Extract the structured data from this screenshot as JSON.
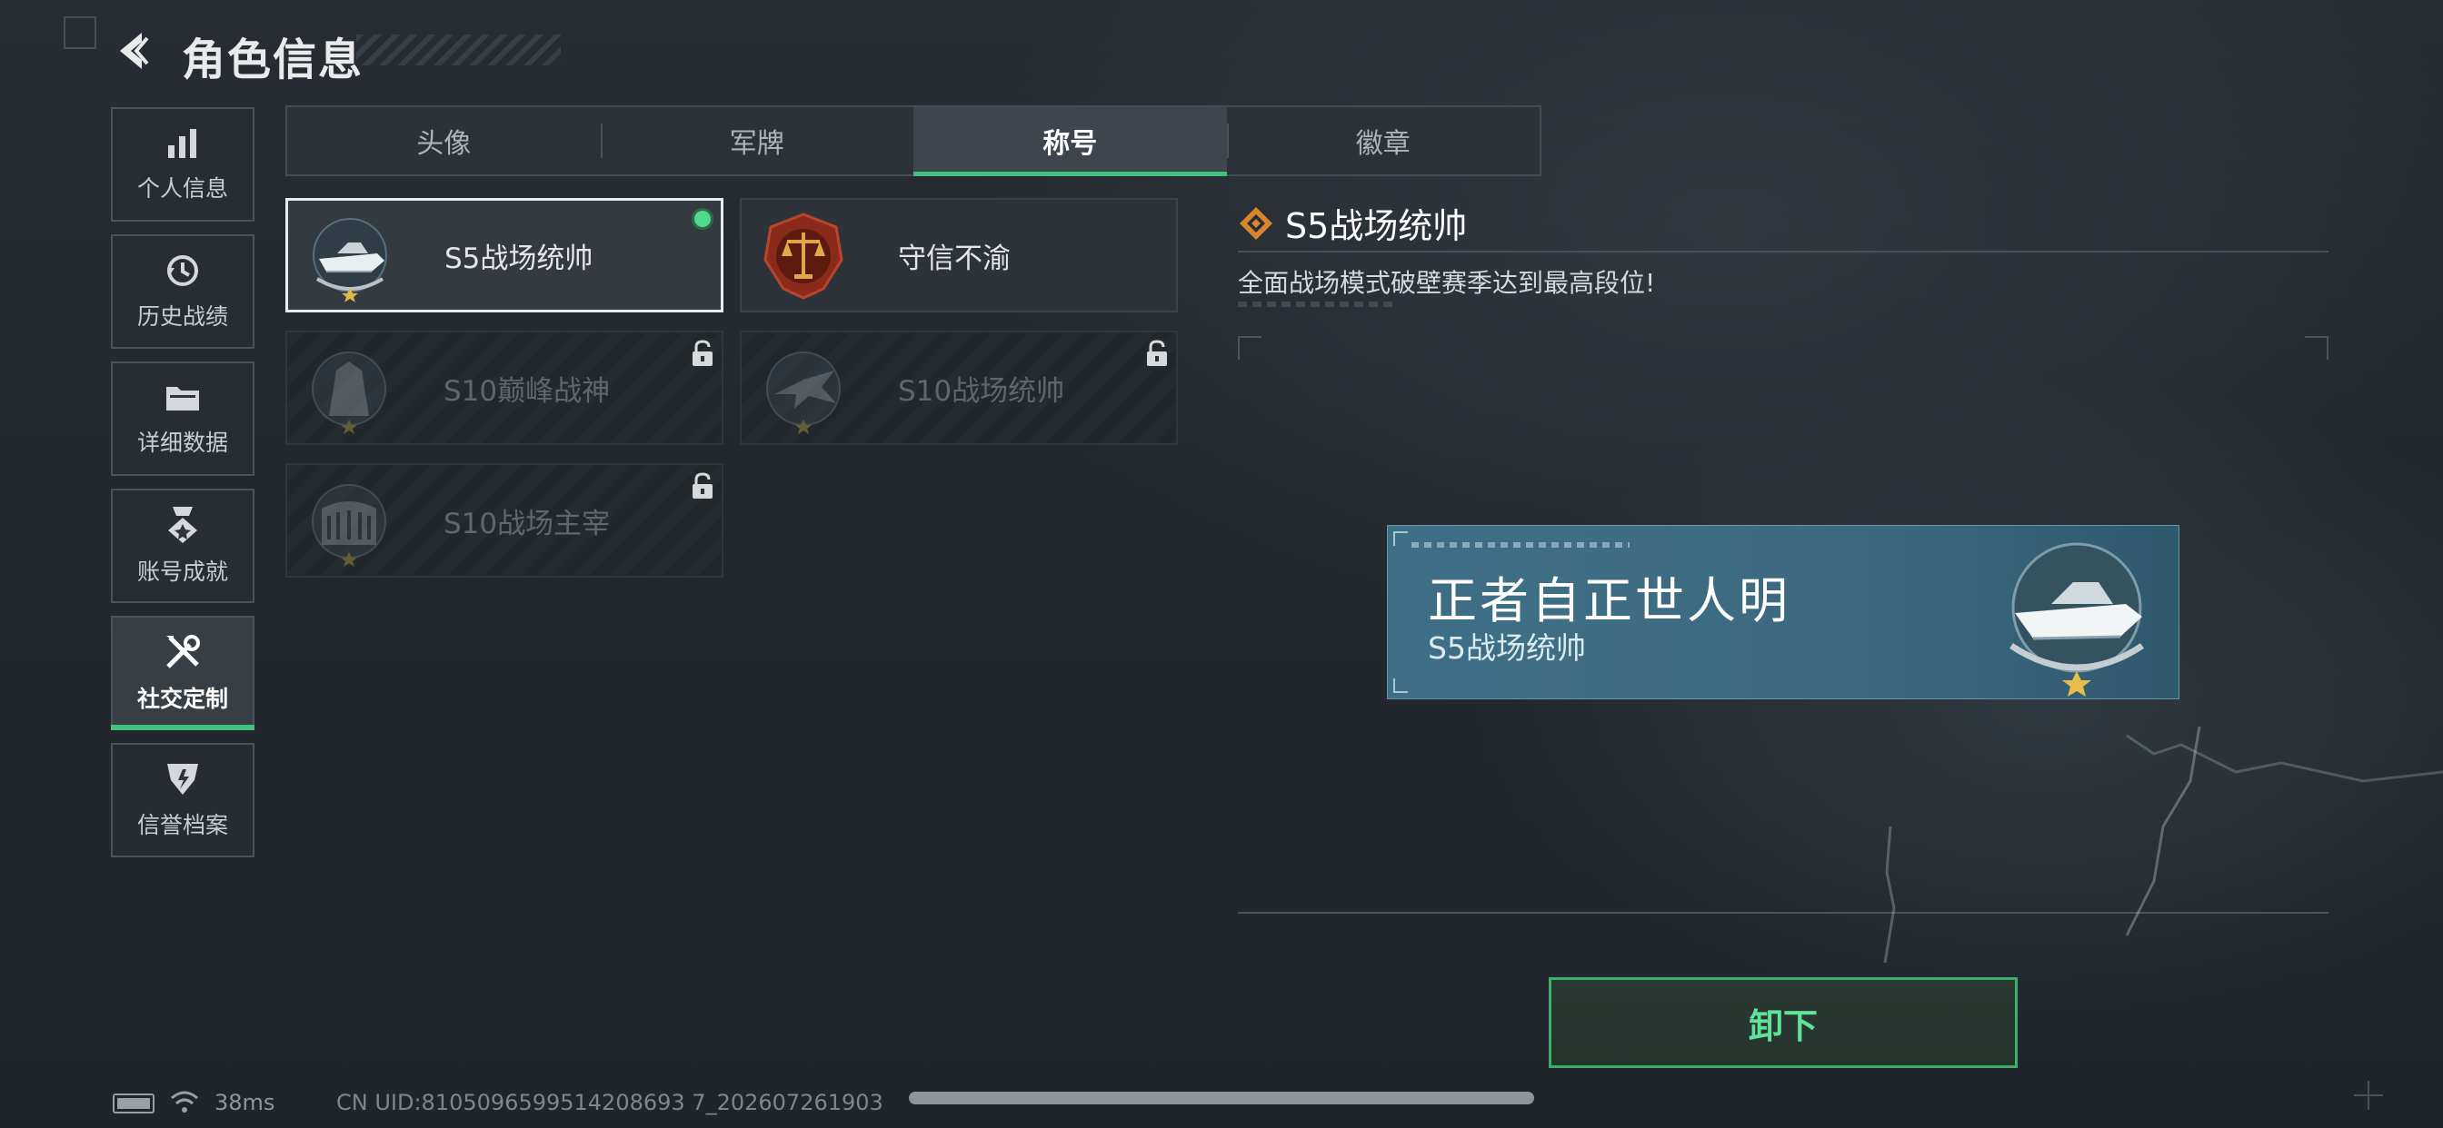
{
  "header": {
    "title": "角色信息"
  },
  "nav": [
    {
      "label": "个人信息",
      "icon": "bar-chart-icon"
    },
    {
      "label": "历史战绩",
      "icon": "history-icon"
    },
    {
      "label": "详细数据",
      "icon": "folder-icon"
    },
    {
      "label": "账号成就",
      "icon": "medal-icon"
    },
    {
      "label": "社交定制",
      "icon": "tools-icon",
      "active": true
    },
    {
      "label": "信誉档案",
      "icon": "shield-icon"
    }
  ],
  "tabs": [
    {
      "label": "头像"
    },
    {
      "label": "军牌"
    },
    {
      "label": "称号",
      "active": true
    },
    {
      "label": "徽章"
    }
  ],
  "titles": [
    {
      "label": "S5战场统帅",
      "emblem": "speedboat-emblem-icon",
      "state": "equipped-selected"
    },
    {
      "label": "守信不渝",
      "emblem": "scales-emblem-icon",
      "state": "unlocked"
    },
    {
      "label": "S10巅峰战神",
      "emblem": "tower-emblem-icon",
      "state": "locked"
    },
    {
      "label": "S10战场统帅",
      "emblem": "jet-emblem-icon",
      "state": "locked"
    },
    {
      "label": "S10战场主宰",
      "emblem": "colosseum-emblem-icon",
      "state": "locked"
    }
  ],
  "detail": {
    "title": "S5战场统帅",
    "description": "全面战场模式破壁赛季达到最高段位!",
    "nameplate": {
      "slogan": "正者自正世人明",
      "title": "S5战场统帅"
    }
  },
  "actions": {
    "unequip_label": "卸下"
  },
  "status": {
    "ping": "38ms",
    "uid": "CN UID:8105096599514208693 7_202607261903"
  },
  "colors": {
    "accent_green": "#43c27d",
    "nameplate_blue": "#3f6f86",
    "equipped_dot": "#52d98b"
  }
}
